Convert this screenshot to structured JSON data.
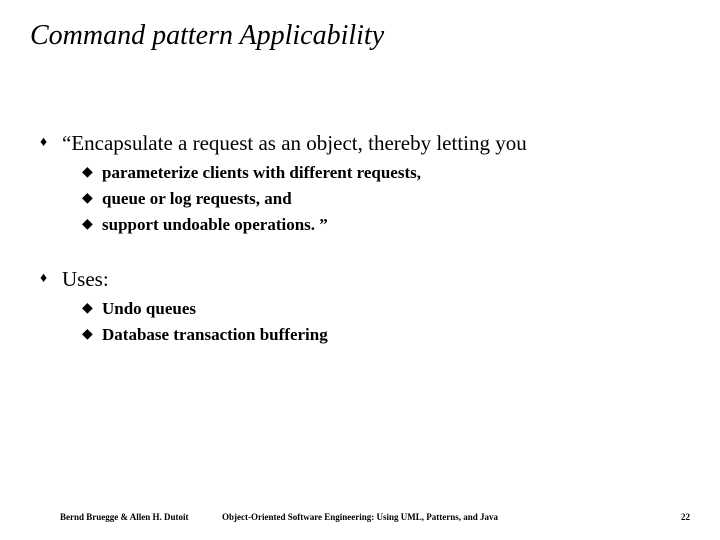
{
  "title": "Command pattern  Applicability",
  "body": {
    "items": [
      {
        "text": "“Encapsulate a request as an object, thereby letting you",
        "sub": [
          "parameterize clients with different requests,",
          "queue or log requests, and",
          "support undoable operations. ”"
        ]
      },
      {
        "text": "Uses:",
        "sub": [
          "Undo queues",
          "Database transaction buffering"
        ]
      }
    ]
  },
  "footer": {
    "left": "Bernd Bruegge & Allen H. Dutoit",
    "center": "Object-Oriented Software Engineering: Using UML, Patterns, and Java",
    "right": "22"
  },
  "bullets": {
    "l1": "♦",
    "l2": "◆"
  }
}
